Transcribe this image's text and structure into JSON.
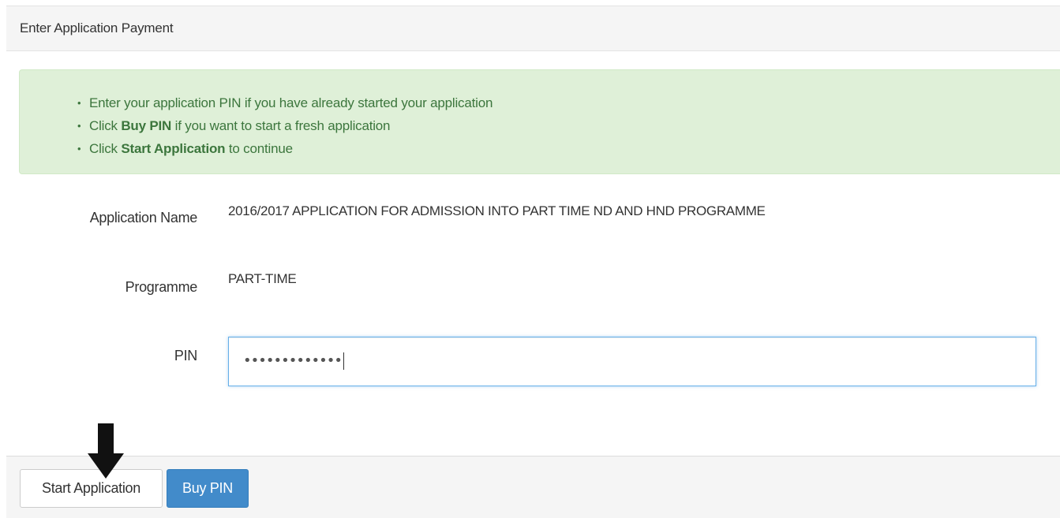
{
  "panel": {
    "title": "Enter Application Payment"
  },
  "instructions": {
    "items": [
      {
        "pre": "Enter your application PIN if you have already started your application",
        "bold": "",
        "post": ""
      },
      {
        "pre": "Click ",
        "bold": "Buy PIN",
        "post": " if you want to start a fresh application"
      },
      {
        "pre": "Click ",
        "bold": "Start Application",
        "post": " to continue"
      }
    ]
  },
  "form": {
    "application_name_label": "Application Name",
    "application_name_value": "2016/2017 APPLICATION FOR ADMISSION INTO PART TIME ND AND HND PROGRAMME",
    "programme_label": "Programme",
    "programme_value": "PART-TIME",
    "pin_label": "PIN",
    "pin_masked": "•••••••••••••"
  },
  "footer": {
    "start_label": "Start Application",
    "buy_label": "Buy PIN"
  },
  "annotation": {
    "icon": "down-arrow-icon"
  },
  "colors": {
    "alert_bg": "#dff0d8",
    "alert_text": "#3c763d",
    "primary": "#428bca",
    "input_focus": "#66afe9"
  }
}
